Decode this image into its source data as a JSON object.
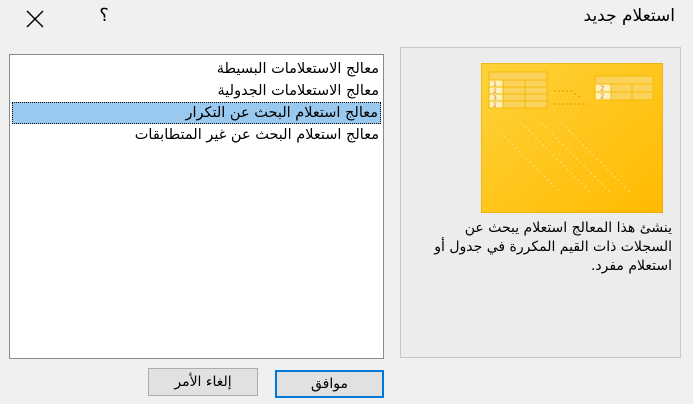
{
  "window": {
    "title": "استعلام جديد",
    "help_glyph": "؟"
  },
  "wizard_list": {
    "items": [
      {
        "label": "معالج الاستعلامات البسيطة",
        "selected": false
      },
      {
        "label": "معالج الاستعلامات الجدولية",
        "selected": false
      },
      {
        "label": "معالج استعلام البحث عن التكرار",
        "selected": true
      },
      {
        "label": "معالج استعلام البحث عن غير المتطابقات",
        "selected": false
      }
    ]
  },
  "preview": {
    "description": "ينشئ هذا المعالج استعلام يبحث عن السجلات ذات القيم المكررة في جدول أو استعلام مفرد.",
    "left_table_numbers": [
      "1",
      "2",
      "3",
      "2"
    ],
    "right_table_numbers": [
      "2",
      "2"
    ],
    "colors": {
      "background": "#ffc20e",
      "cell": "#fbd35c",
      "number": "#d07a2a"
    }
  },
  "buttons": {
    "ok_label": "موافق",
    "cancel_label": "إلغاء الأمر"
  },
  "colors": {
    "selection": "#99c9ef",
    "focus_border": "#0078d7"
  }
}
